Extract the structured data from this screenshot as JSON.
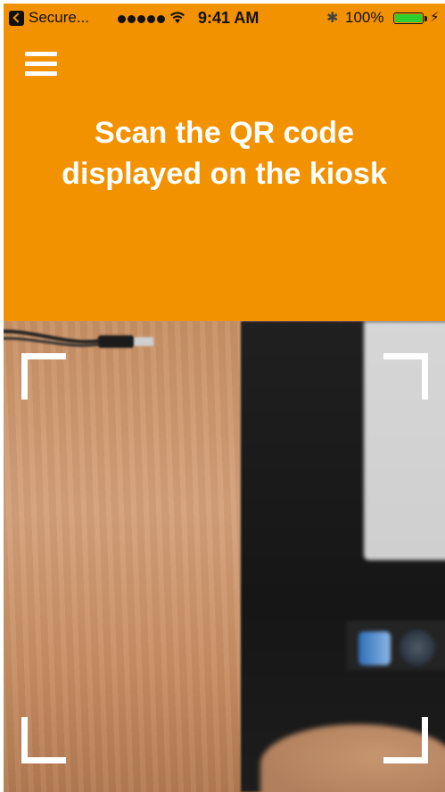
{
  "status_bar": {
    "back_app_label": "Secure...",
    "time": "9:41 AM",
    "battery_percent": "100%",
    "battery_level": 1.0,
    "signal_bars": 5,
    "icons": [
      "back-to-app-icon",
      "signal-icon",
      "wifi-icon",
      "bluetooth-icon",
      "battery-icon",
      "charging-icon"
    ]
  },
  "header": {
    "menu_icon": "hamburger-menu-icon",
    "title_line1": "Scan the QR code",
    "title_line2": "displayed on the kiosk",
    "background_color": "#f39200",
    "text_color": "#ffffff"
  },
  "scanner": {
    "frame_color": "#ffffff",
    "corners": [
      "top-left",
      "top-right",
      "bottom-left",
      "bottom-right"
    ]
  }
}
